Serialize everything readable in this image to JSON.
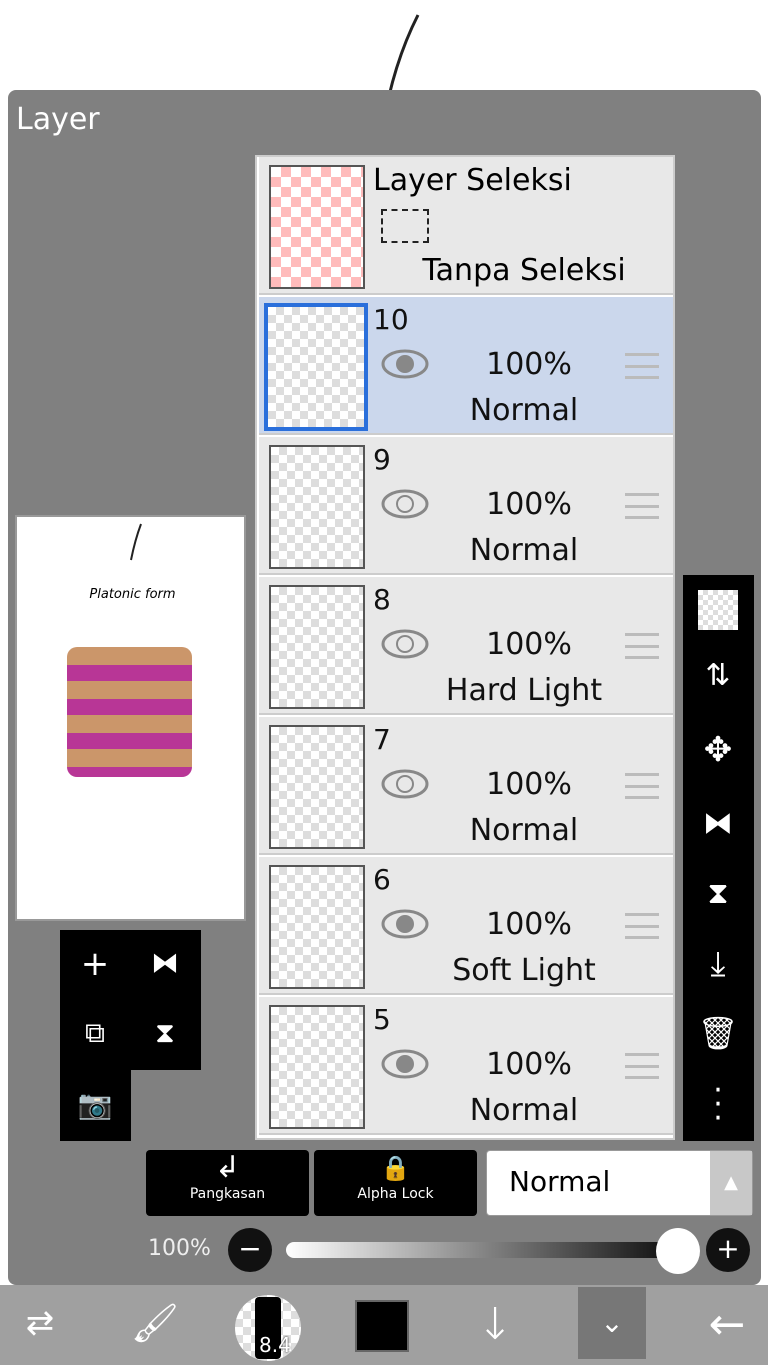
{
  "panel": {
    "title": "Layer"
  },
  "selection_layer": {
    "title": "Layer Seleksi",
    "status": "Tanpa Seleksi"
  },
  "layers": [
    {
      "number": "10",
      "opacity": "100%",
      "mode": "Normal",
      "visible": true,
      "selected": true
    },
    {
      "number": "9",
      "opacity": "100%",
      "mode": "Normal",
      "visible": true,
      "selected": false
    },
    {
      "number": "8",
      "opacity": "100%",
      "mode": "Hard Light",
      "visible": true,
      "selected": false
    },
    {
      "number": "7",
      "opacity": "100%",
      "mode": "Normal",
      "visible": true,
      "selected": false
    },
    {
      "number": "6",
      "opacity": "100%",
      "mode": "Soft Light",
      "visible": true,
      "selected": false
    },
    {
      "number": "5",
      "opacity": "100%",
      "mode": "Normal",
      "visible": true,
      "selected": false
    }
  ],
  "preview": {
    "caption": "Platonic form"
  },
  "controls": {
    "clipping_label": "Pangkasan",
    "alpha_lock_label": "Alpha Lock",
    "blend_mode": "Normal",
    "opacity_label": "100%",
    "opacity_value": 100
  },
  "toolbar": {
    "brush_size": "8.4",
    "color": "#000000"
  },
  "colors": {
    "accent": "#2a6fdb",
    "selected_row": "#cbd7ec",
    "panel": "#808080"
  }
}
